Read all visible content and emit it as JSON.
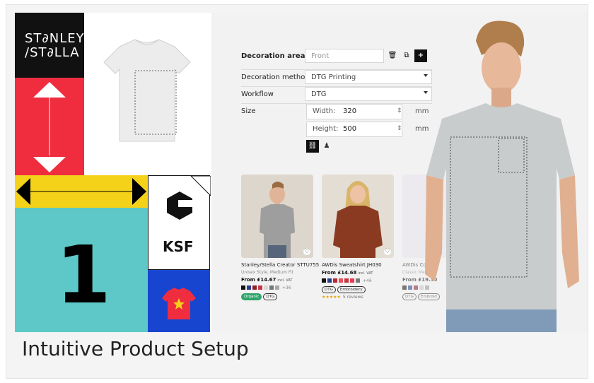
{
  "brand": {
    "line1": "ST∂NLEY",
    "line2": "/ST∂LLA"
  },
  "badge": {
    "ksf": "KSF",
    "one": "1"
  },
  "config": {
    "decoration_area": {
      "label": "Decoration area ▾",
      "value": "Front"
    },
    "decoration_method": {
      "label": "Decoration method",
      "value": "DTG Printing"
    },
    "workflow": {
      "label": "Workflow",
      "value": "DTG"
    },
    "size": {
      "label": "Size",
      "width_label": "Width:",
      "width_value": "320",
      "height_label": "Height:",
      "height_value": "500",
      "unit": "mm"
    }
  },
  "products": [
    {
      "title": "Stanley/Stella Creator STTU755",
      "subtitle": "Unisex Style, Medium Fit",
      "price": "From £14.67",
      "vat": "incl. VAT",
      "swatches": [
        "#111111",
        "#2a3e8a",
        "#8a1f2a",
        "#c8343f",
        "#d9d9d9",
        "#777777",
        "#a8a8a8"
      ],
      "more": "+36",
      "tags": [
        {
          "text": "Organic",
          "style": "green"
        },
        {
          "text": "DTG",
          "style": "outline"
        }
      ],
      "rating": ""
    },
    {
      "title": "AWDis Sweatshirt JH030",
      "subtitle": "",
      "price": "From £14.68",
      "vat": "incl. VAT",
      "swatches": [
        "#111111",
        "#2a3e8a",
        "#b02a3a",
        "#e6505c",
        "#c8343f",
        "#e83a55",
        "#7a7a7a"
      ],
      "more": "+46",
      "tags": [
        {
          "text": "DTG",
          "style": "outline"
        },
        {
          "text": "Embroidery",
          "style": "outline"
        }
      ],
      "rating": "★★★★★",
      "reviews": "5 reviews"
    },
    {
      "title": "AWDis Coll",
      "subtitle": "Classic Mens",
      "price": "From £19.30",
      "vat": "",
      "swatches": [
        "#111111",
        "#2a3e8a",
        "#8a1f2a",
        "#c8c8c8",
        "#999999"
      ],
      "more": "",
      "tags": [
        {
          "text": "DTG",
          "style": "outline"
        },
        {
          "text": "Embroid",
          "style": "outline"
        }
      ],
      "rating": ""
    }
  ],
  "caption": "Intuitive Product Setup",
  "colors": {
    "red": "#ef2d3f",
    "yellow": "#f4d21a",
    "teal": "#5ec8c8",
    "blue": "#1845d0"
  }
}
